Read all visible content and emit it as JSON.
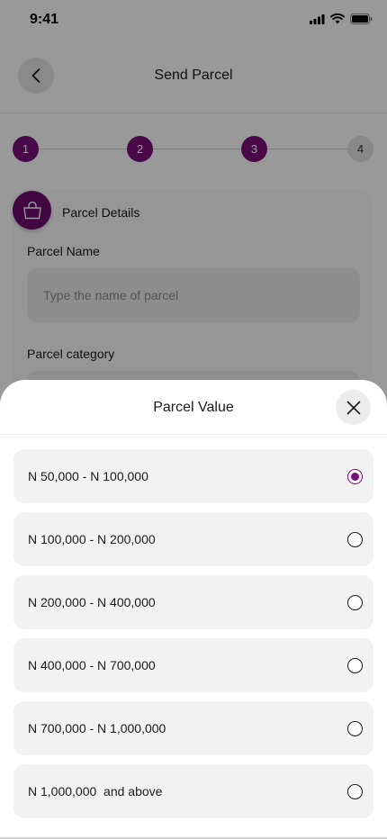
{
  "status_bar": {
    "time": "9:41"
  },
  "header": {
    "title": "Send Parcel"
  },
  "stepper": {
    "steps": [
      "1",
      "2",
      "3",
      "4"
    ],
    "current": 3
  },
  "details_card": {
    "title": "Parcel Details",
    "parcel_name_label": "Parcel Name",
    "parcel_name_placeholder": "Type the name of parcel",
    "parcel_category_label": "Parcel category"
  },
  "sheet": {
    "title": "Parcel Value",
    "options": [
      {
        "label": "N 50,000 - N 100,000",
        "selected": true
      },
      {
        "label": "N 100,000 - N 200,000",
        "selected": false
      },
      {
        "label": "N 200,000 - N 400,000",
        "selected": false
      },
      {
        "label": "N 400,000 - N 700,000",
        "selected": false
      },
      {
        "label": "N 700,000 - N 1,000,000",
        "selected": false
      },
      {
        "label": "N 1,000,000  and above",
        "selected": false
      }
    ]
  },
  "colors": {
    "accent": "#7a0f7a",
    "overlay": "rgba(0,0,0,0.40)"
  },
  "icons": [
    "back-arrow-icon",
    "bag-icon",
    "close-icon",
    "signal-icon",
    "wifi-icon",
    "battery-icon"
  ]
}
